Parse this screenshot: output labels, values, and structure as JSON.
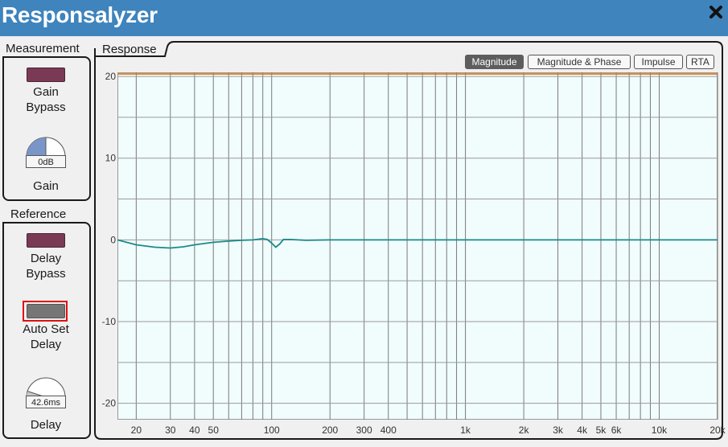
{
  "app": {
    "title": "Responsalyzer"
  },
  "measurement": {
    "label": "Measurement",
    "gain_bypass_label": "Gain\nBypass",
    "gain_value": "0dB",
    "gain_label": "Gain",
    "gain_level": 0.25,
    "bypass_color": "#7a3a55"
  },
  "reference": {
    "label": "Reference",
    "delay_bypass_label": "Delay\nBypass",
    "auto_set_label": "Auto Set\nDelay",
    "delay_value": "42.6ms",
    "delay_label": "Delay",
    "delay_level": 0.1
  },
  "response": {
    "label": "Response",
    "tabs": [
      {
        "label": "Magnitude",
        "active": true
      },
      {
        "label": "Magnitude & Phase",
        "active": false
      },
      {
        "label": "Impulse",
        "active": false
      },
      {
        "label": "RTA",
        "active": false
      }
    ]
  },
  "chart_data": {
    "type": "line",
    "xscale": "log",
    "xlim": [
      16,
      20000
    ],
    "ylim": [
      -22,
      20.5
    ],
    "x_ticks": [
      {
        "v": 20,
        "label": "20"
      },
      {
        "v": 30,
        "label": "30"
      },
      {
        "v": 40,
        "label": "40"
      },
      {
        "v": 50,
        "label": "50"
      },
      {
        "v": 100,
        "label": "100"
      },
      {
        "v": 200,
        "label": "200"
      },
      {
        "v": 300,
        "label": "300"
      },
      {
        "v": 400,
        "label": "400"
      },
      {
        "v": 1000,
        "label": "1k"
      },
      {
        "v": 2000,
        "label": "2k"
      },
      {
        "v": 3000,
        "label": "3k"
      },
      {
        "v": 4000,
        "label": "4k"
      },
      {
        "v": 5000,
        "label": "5k"
      },
      {
        "v": 6000,
        "label": "6k"
      },
      {
        "v": 10000,
        "label": "10k"
      },
      {
        "v": 20000,
        "label": "20k"
      }
    ],
    "y_ticks": [
      {
        "v": 20,
        "label": "20"
      },
      {
        "v": 10,
        "label": "10"
      },
      {
        "v": 0,
        "label": "0"
      },
      {
        "v": -10,
        "label": "-10"
      },
      {
        "v": -20,
        "label": "-20"
      }
    ],
    "series": [
      {
        "color": "#e07a1a",
        "x": [
          16,
          20000
        ],
        "y": [
          20.3,
          20.3
        ]
      },
      {
        "color": "#1a8a8a",
        "x": [
          16,
          20,
          25,
          30,
          35,
          40,
          50,
          60,
          70,
          80,
          90,
          95,
          100,
          105,
          110,
          115,
          125,
          150,
          200,
          1000,
          20000
        ],
        "y": [
          0,
          -0.6,
          -0.9,
          -1.0,
          -0.85,
          -0.6,
          -0.3,
          -0.15,
          -0.05,
          0,
          0.15,
          0.05,
          -0.4,
          -0.9,
          -0.5,
          0.05,
          0.05,
          -0.05,
          0,
          0,
          0
        ]
      }
    ]
  },
  "icons": {
    "close": "close-icon"
  }
}
